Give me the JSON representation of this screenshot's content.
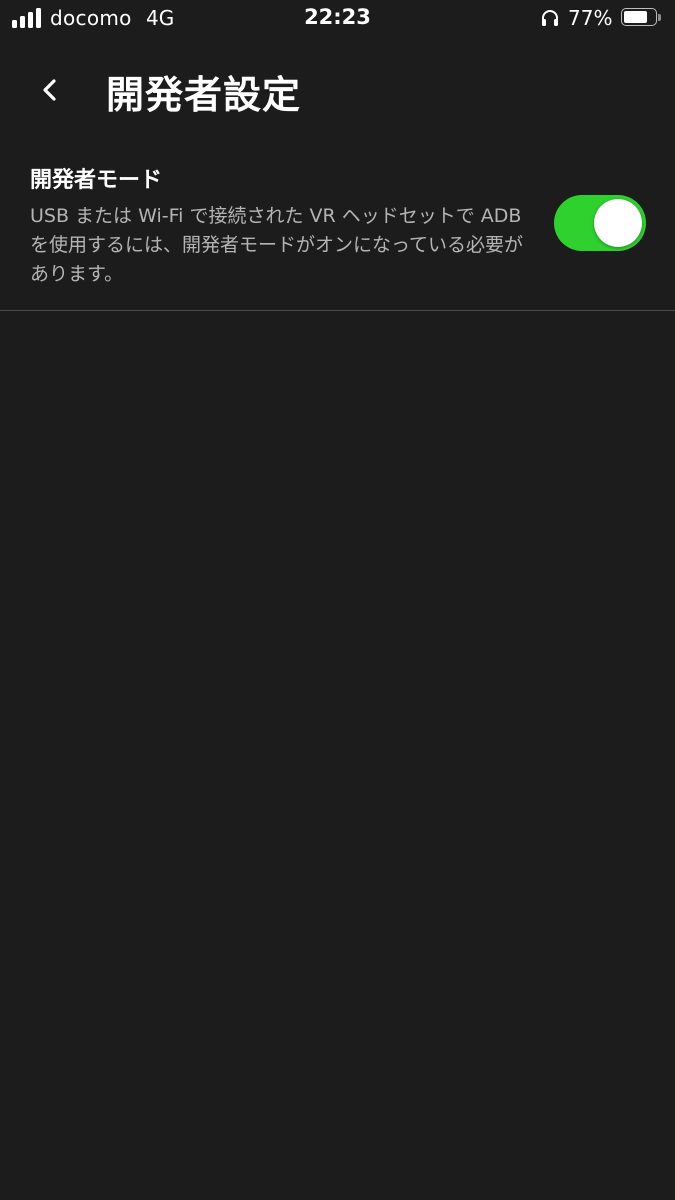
{
  "status_bar": {
    "carrier": "docomo",
    "network": "4G",
    "time": "22:23",
    "battery_percent_label": "77%",
    "battery_level": 0.77,
    "signal_bars": 4,
    "headphones_icon": "headphones-icon"
  },
  "header": {
    "back_icon": "chevron-left-icon",
    "title": "開発者設定"
  },
  "developer_mode": {
    "title": "開発者モード",
    "description": "USB または Wi-Fi で接続された VR ヘッドセットで ADB を使用するには、開発者モードがオンになっている必要があります。",
    "enabled": true,
    "toggle_on_color": "#2ed12e"
  },
  "colors": {
    "background": "#1c1c1c",
    "text_primary": "#ffffff",
    "text_secondary": "#b4b4b4",
    "divider": "#4a4a4a"
  }
}
